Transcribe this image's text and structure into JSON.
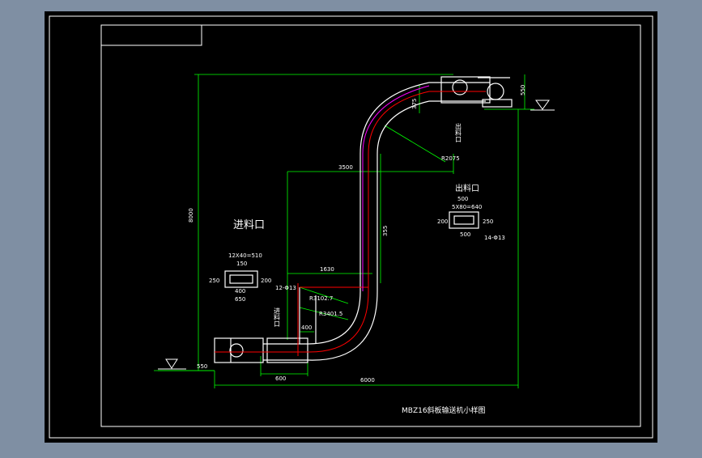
{
  "colors": {
    "background": "#7f8fa3",
    "sheet": "#000000",
    "frame": "#ffffff",
    "dimension": "#00ff00",
    "casing": "#ffffff",
    "chain": "#ff0000",
    "inner_rail": "#ff00ff",
    "note": "#ffff00"
  },
  "labels": {
    "inlet_title": "进料口",
    "outlet_title": "出料口",
    "inlet_side": "进料口",
    "outlet_side": "出料口",
    "drawing_title": "MBZ16斜板输送机小样图"
  },
  "dimensions": {
    "total_height": "8000",
    "total_length": "6000",
    "top_horizontal": "3500",
    "mid_horizontal": "1630",
    "bottom_run": "600",
    "inlet_width": "400",
    "vertical_run": "355",
    "upper_radius": "R2075",
    "lower_radius_1": "R3102.7",
    "lower_radius_2": "R3401.5",
    "head_height": "550",
    "tail_height": "550",
    "head_offset": "375",
    "inlet_slot": "12X40=510",
    "inlet_w1": "150",
    "inlet_w2": "400",
    "inlet_w3": "650",
    "inlet_h": "250",
    "inlet_h2": "200",
    "inlet_bolts": "12-Φ13",
    "outlet_slot": "5X80=640",
    "outlet_w1": "500",
    "outlet_w2": "500",
    "outlet_h": "200",
    "outlet_h2": "250",
    "outlet_bolts": "14-Φ13"
  }
}
